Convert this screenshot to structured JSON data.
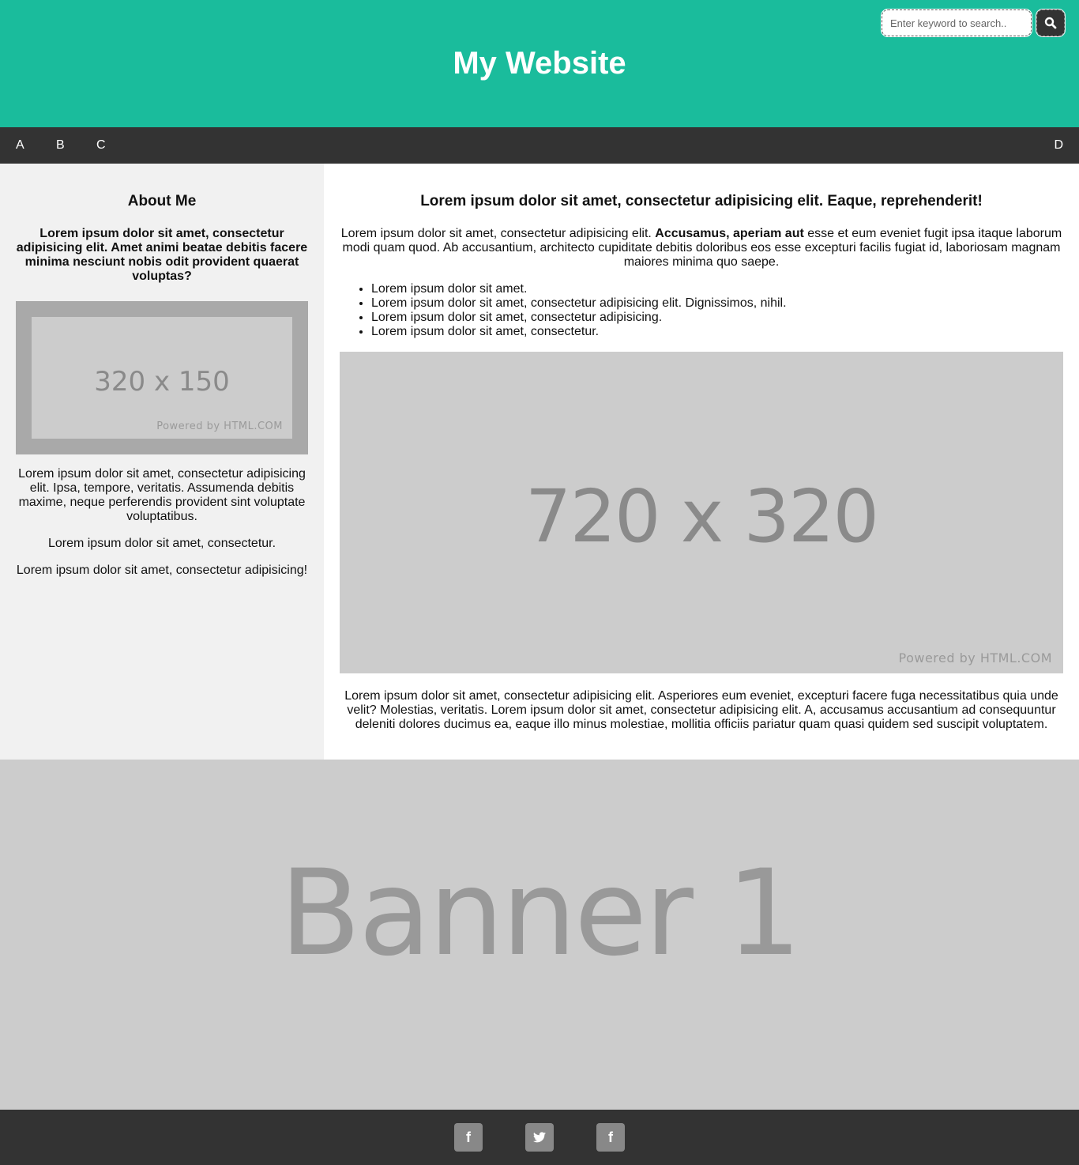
{
  "header": {
    "title": "My Website",
    "search_placeholder": "Enter keyword to search.."
  },
  "nav": {
    "left": [
      "A",
      "B",
      "C"
    ],
    "right": "D"
  },
  "sidebar": {
    "heading": "About Me",
    "subheading": "Lorem ipsum dolor sit amet, consectetur adipisicing elit. Amet animi beatae debitis facere minima nesciunt nobis odit provident quaerat voluptas?",
    "image_text": "320 x 150",
    "image_powered": "Powered by HTML.COM",
    "paragraphs": [
      "Lorem ipsum dolor sit amet, consectetur adipisicing elit. Ipsa, tempore, veritatis. Assumenda debitis maxime, neque perferendis provident sint voluptate voluptatibus.",
      "Lorem ipsum dolor sit amet, consectetur.",
      "Lorem ipsum dolor sit amet, consectetur adipisicing!"
    ]
  },
  "main": {
    "heading": "Lorem ipsum dolor sit amet, consectetur adipisicing elit. Eaque, reprehenderit!",
    "intro_start": "Lorem ipsum dolor sit amet, consectetur adipisicing elit. ",
    "intro_bold": "Accusamus, aperiam aut",
    "intro_end": " esse et eum eveniet fugit ipsa itaque laborum modi quam quod. Ab accusantium, architecto cupiditate debitis doloribus eos esse excepturi facilis fugiat id, laboriosam magnam maiores minima quo saepe.",
    "list": [
      "Lorem ipsum dolor sit amet.",
      "Lorem ipsum dolor sit amet, consectetur adipisicing elit. Dignissimos, nihil.",
      "Lorem ipsum dolor sit amet, consectetur adipisicing.",
      "Lorem ipsum dolor sit amet, consectetur."
    ],
    "image_text": "720 x 320",
    "image_powered": "Powered by HTML.COM",
    "closing": "Lorem ipsum dolor sit amet, consectetur adipisicing elit. Asperiores eum eveniet, excepturi facere fuga necessitatibus quia unde velit? Molestias, veritatis. Lorem ipsum dolor sit amet, consectetur adipisicing elit. A, accusamus accusantium ad consequuntur deleniti dolores ducimus ea, eaque illo minus molestiae, mollitia officiis pariatur quam quasi quidem sed suscipit voluptatem."
  },
  "banner": {
    "text": "Banner 1"
  },
  "footer": {
    "social": [
      {
        "icon": "facebook-icon",
        "glyph": "f"
      },
      {
        "icon": "twitter-icon",
        "glyph": ""
      },
      {
        "icon": "facebook-icon",
        "glyph": "f"
      }
    ]
  },
  "colors": {
    "header_bg": "#1abc9c",
    "nav_bg": "#333333",
    "sidebar_bg": "#f1f1f1",
    "placeholder_bg": "#cccccc",
    "footer_bg": "#333333"
  }
}
